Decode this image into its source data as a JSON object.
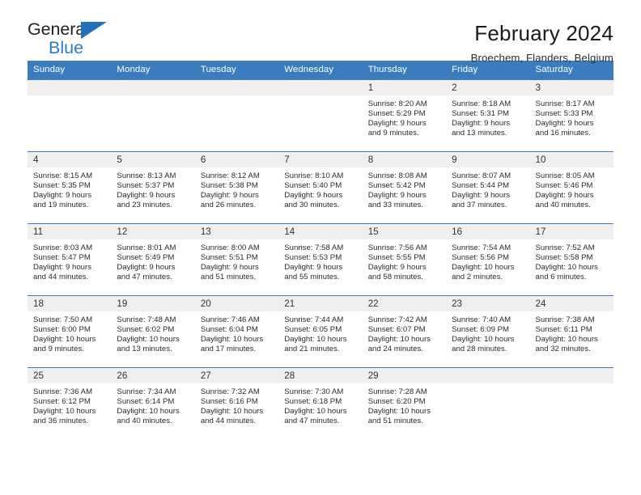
{
  "brand": {
    "name_part1": "General",
    "name_part2": "Blue",
    "triangle_color": "#1f72b8",
    "blue": "#2b7cc3"
  },
  "header": {
    "title": "February 2024",
    "subtitle": "Broechem, Flanders, Belgium",
    "header_bg": "#3b7cbe"
  },
  "weekday_headers": [
    "Sunday",
    "Monday",
    "Tuesday",
    "Wednesday",
    "Thursday",
    "Friday",
    "Saturday"
  ],
  "weeks": [
    [
      {
        "day": "",
        "blank": true,
        "sunrise": "",
        "sunset": "",
        "daylight1": "",
        "daylight2": ""
      },
      {
        "day": "",
        "blank": true,
        "sunrise": "",
        "sunset": "",
        "daylight1": "",
        "daylight2": ""
      },
      {
        "day": "",
        "blank": true,
        "sunrise": "",
        "sunset": "",
        "daylight1": "",
        "daylight2": ""
      },
      {
        "day": "",
        "blank": true,
        "sunrise": "",
        "sunset": "",
        "daylight1": "",
        "daylight2": ""
      },
      {
        "day": "1",
        "blank": false,
        "sunrise": "Sunrise: 8:20 AM",
        "sunset": "Sunset: 5:29 PM",
        "daylight1": "Daylight: 9 hours",
        "daylight2": "and 9 minutes."
      },
      {
        "day": "2",
        "blank": false,
        "sunrise": "Sunrise: 8:18 AM",
        "sunset": "Sunset: 5:31 PM",
        "daylight1": "Daylight: 9 hours",
        "daylight2": "and 13 minutes."
      },
      {
        "day": "3",
        "blank": false,
        "sunrise": "Sunrise: 8:17 AM",
        "sunset": "Sunset: 5:33 PM",
        "daylight1": "Daylight: 9 hours",
        "daylight2": "and 16 minutes."
      }
    ],
    [
      {
        "day": "4",
        "blank": false,
        "sunrise": "Sunrise: 8:15 AM",
        "sunset": "Sunset: 5:35 PM",
        "daylight1": "Daylight: 9 hours",
        "daylight2": "and 19 minutes."
      },
      {
        "day": "5",
        "blank": false,
        "sunrise": "Sunrise: 8:13 AM",
        "sunset": "Sunset: 5:37 PM",
        "daylight1": "Daylight: 9 hours",
        "daylight2": "and 23 minutes."
      },
      {
        "day": "6",
        "blank": false,
        "sunrise": "Sunrise: 8:12 AM",
        "sunset": "Sunset: 5:38 PM",
        "daylight1": "Daylight: 9 hours",
        "daylight2": "and 26 minutes."
      },
      {
        "day": "7",
        "blank": false,
        "sunrise": "Sunrise: 8:10 AM",
        "sunset": "Sunset: 5:40 PM",
        "daylight1": "Daylight: 9 hours",
        "daylight2": "and 30 minutes."
      },
      {
        "day": "8",
        "blank": false,
        "sunrise": "Sunrise: 8:08 AM",
        "sunset": "Sunset: 5:42 PM",
        "daylight1": "Daylight: 9 hours",
        "daylight2": "and 33 minutes."
      },
      {
        "day": "9",
        "blank": false,
        "sunrise": "Sunrise: 8:07 AM",
        "sunset": "Sunset: 5:44 PM",
        "daylight1": "Daylight: 9 hours",
        "daylight2": "and 37 minutes."
      },
      {
        "day": "10",
        "blank": false,
        "sunrise": "Sunrise: 8:05 AM",
        "sunset": "Sunset: 5:46 PM",
        "daylight1": "Daylight: 9 hours",
        "daylight2": "and 40 minutes."
      }
    ],
    [
      {
        "day": "11",
        "blank": false,
        "sunrise": "Sunrise: 8:03 AM",
        "sunset": "Sunset: 5:47 PM",
        "daylight1": "Daylight: 9 hours",
        "daylight2": "and 44 minutes."
      },
      {
        "day": "12",
        "blank": false,
        "sunrise": "Sunrise: 8:01 AM",
        "sunset": "Sunset: 5:49 PM",
        "daylight1": "Daylight: 9 hours",
        "daylight2": "and 47 minutes."
      },
      {
        "day": "13",
        "blank": false,
        "sunrise": "Sunrise: 8:00 AM",
        "sunset": "Sunset: 5:51 PM",
        "daylight1": "Daylight: 9 hours",
        "daylight2": "and 51 minutes."
      },
      {
        "day": "14",
        "blank": false,
        "sunrise": "Sunrise: 7:58 AM",
        "sunset": "Sunset: 5:53 PM",
        "daylight1": "Daylight: 9 hours",
        "daylight2": "and 55 minutes."
      },
      {
        "day": "15",
        "blank": false,
        "sunrise": "Sunrise: 7:56 AM",
        "sunset": "Sunset: 5:55 PM",
        "daylight1": "Daylight: 9 hours",
        "daylight2": "and 58 minutes."
      },
      {
        "day": "16",
        "blank": false,
        "sunrise": "Sunrise: 7:54 AM",
        "sunset": "Sunset: 5:56 PM",
        "daylight1": "Daylight: 10 hours",
        "daylight2": "and 2 minutes."
      },
      {
        "day": "17",
        "blank": false,
        "sunrise": "Sunrise: 7:52 AM",
        "sunset": "Sunset: 5:58 PM",
        "daylight1": "Daylight: 10 hours",
        "daylight2": "and 6 minutes."
      }
    ],
    [
      {
        "day": "18",
        "blank": false,
        "sunrise": "Sunrise: 7:50 AM",
        "sunset": "Sunset: 6:00 PM",
        "daylight1": "Daylight: 10 hours",
        "daylight2": "and 9 minutes."
      },
      {
        "day": "19",
        "blank": false,
        "sunrise": "Sunrise: 7:48 AM",
        "sunset": "Sunset: 6:02 PM",
        "daylight1": "Daylight: 10 hours",
        "daylight2": "and 13 minutes."
      },
      {
        "day": "20",
        "blank": false,
        "sunrise": "Sunrise: 7:46 AM",
        "sunset": "Sunset: 6:04 PM",
        "daylight1": "Daylight: 10 hours",
        "daylight2": "and 17 minutes."
      },
      {
        "day": "21",
        "blank": false,
        "sunrise": "Sunrise: 7:44 AM",
        "sunset": "Sunset: 6:05 PM",
        "daylight1": "Daylight: 10 hours",
        "daylight2": "and 21 minutes."
      },
      {
        "day": "22",
        "blank": false,
        "sunrise": "Sunrise: 7:42 AM",
        "sunset": "Sunset: 6:07 PM",
        "daylight1": "Daylight: 10 hours",
        "daylight2": "and 24 minutes."
      },
      {
        "day": "23",
        "blank": false,
        "sunrise": "Sunrise: 7:40 AM",
        "sunset": "Sunset: 6:09 PM",
        "daylight1": "Daylight: 10 hours",
        "daylight2": "and 28 minutes."
      },
      {
        "day": "24",
        "blank": false,
        "sunrise": "Sunrise: 7:38 AM",
        "sunset": "Sunset: 6:11 PM",
        "daylight1": "Daylight: 10 hours",
        "daylight2": "and 32 minutes."
      }
    ],
    [
      {
        "day": "25",
        "blank": false,
        "sunrise": "Sunrise: 7:36 AM",
        "sunset": "Sunset: 6:12 PM",
        "daylight1": "Daylight: 10 hours",
        "daylight2": "and 36 minutes."
      },
      {
        "day": "26",
        "blank": false,
        "sunrise": "Sunrise: 7:34 AM",
        "sunset": "Sunset: 6:14 PM",
        "daylight1": "Daylight: 10 hours",
        "daylight2": "and 40 minutes."
      },
      {
        "day": "27",
        "blank": false,
        "sunrise": "Sunrise: 7:32 AM",
        "sunset": "Sunset: 6:16 PM",
        "daylight1": "Daylight: 10 hours",
        "daylight2": "and 44 minutes."
      },
      {
        "day": "28",
        "blank": false,
        "sunrise": "Sunrise: 7:30 AM",
        "sunset": "Sunset: 6:18 PM",
        "daylight1": "Daylight: 10 hours",
        "daylight2": "and 47 minutes."
      },
      {
        "day": "29",
        "blank": false,
        "sunrise": "Sunrise: 7:28 AM",
        "sunset": "Sunset: 6:20 PM",
        "daylight1": "Daylight: 10 hours",
        "daylight2": "and 51 minutes."
      },
      {
        "day": "",
        "blank": true,
        "sunrise": "",
        "sunset": "",
        "daylight1": "",
        "daylight2": ""
      },
      {
        "day": "",
        "blank": true,
        "sunrise": "",
        "sunset": "",
        "daylight1": "",
        "daylight2": ""
      }
    ]
  ]
}
